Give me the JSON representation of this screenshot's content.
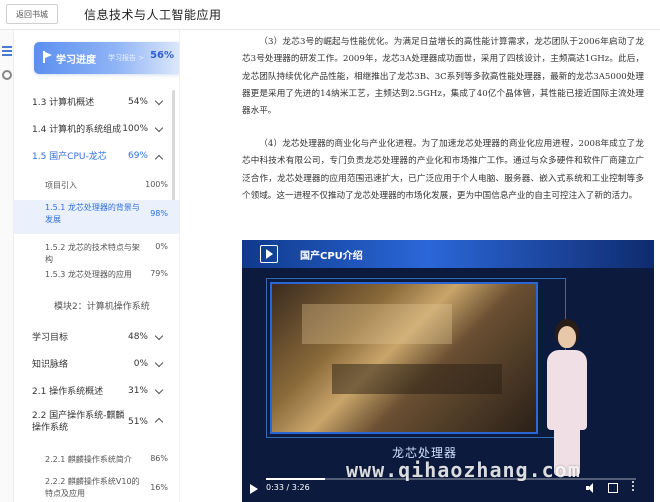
{
  "header": {
    "back_label": "返回书城",
    "title": "信息技术与人工智能应用"
  },
  "progress_card": {
    "title": "学习进度",
    "report_link": "学习报告 >",
    "percent": "56%"
  },
  "sidebar": {
    "items": [
      {
        "label": "1.3 计算机概述",
        "percent": "54%",
        "type": "chapter",
        "expanded": false
      },
      {
        "label": "1.4 计算机的系统组成",
        "percent": "100%",
        "type": "chapter",
        "expanded": false
      },
      {
        "label": "1.5 国产CPU-龙芯",
        "percent": "69%",
        "type": "chapter",
        "expanded": true
      },
      {
        "label": "项目引入",
        "percent": "100%",
        "type": "sub"
      },
      {
        "label": "1.5.1 龙芯处理器的背景与发展",
        "percent": "98%",
        "type": "sub",
        "selected": true
      },
      {
        "label": "1.5.2 龙芯的技术特点与架构",
        "percent": "0%",
        "type": "sub"
      },
      {
        "label": "1.5.3 龙芯处理器的应用",
        "percent": "79%",
        "type": "sub"
      },
      {
        "label": "模块2：计算机操作系统",
        "type": "module"
      },
      {
        "label": "学习目标",
        "percent": "48%",
        "type": "chapter",
        "expanded": false
      },
      {
        "label": "知识脉络",
        "percent": "0%",
        "type": "chapter",
        "expanded": false
      },
      {
        "label": "2.1 操作系统概述",
        "percent": "31%",
        "type": "chapter",
        "expanded": false
      },
      {
        "label": "2.2 国产操作系统-麒麟操作系统",
        "percent": "51%",
        "type": "chapter",
        "expanded": true
      },
      {
        "label": "2.2.1 麒麟操作系统简介",
        "percent": "86%",
        "type": "sub"
      },
      {
        "label": "2.2.2 麒麟操作系统V10的特点及应用",
        "percent": "16%",
        "type": "sub"
      }
    ]
  },
  "content": {
    "paragraphs": [
      "（3）龙芯3号的崛起与性能优化。为满足日益增长的高性能计算需求，龙芯团队于2006年启动了龙芯3号处理器的研发工作。2009年，龙芯3A处理器成功面世，采用了四核设计，主频高达1GHz。此后，龙芯团队持续优化产品性能，相继推出了龙芯3B、3C系列等多款高性能处理器，最新的龙芯3A5000处理器更是采用了先进的14纳米工艺，主频达到2.5GHz，集成了40亿个晶体管，其性能已接近国际主流处理器水平。",
      "（4）龙芯处理器的商业化与产业化进程。为了加速龙芯处理器的商业化应用进程，2008年成立了龙芯中科技术有限公司，专门负责龙芯处理器的产业化和市场推广工作。通过与众多硬件和软件厂商建立广泛合作，龙芯处理器的应用范围迅速扩大，已广泛应用于个人电脑、服务器、嵌入式系统和工业控制等多个领域。这一进程不仅推动了龙芯处理器的市场化发展，更为中国信息产业的自主可控注入了新的活力。"
    ]
  },
  "video": {
    "header_title": "国产CPU介绍",
    "caption": "龙芯处理器",
    "time": "0:33 / 3:26",
    "progress": 0.16
  },
  "watermark": "www.qihaozhang.com"
}
